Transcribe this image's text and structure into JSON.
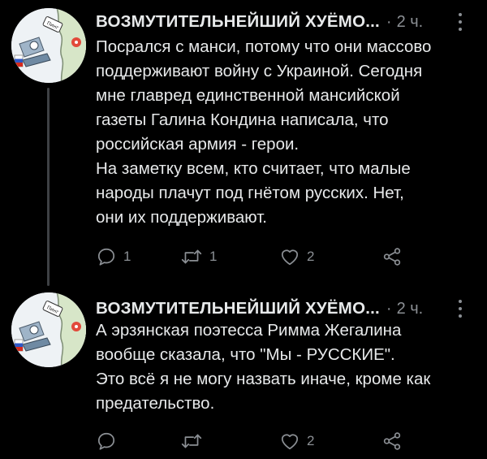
{
  "posts": [
    {
      "author": "ВОЗМУТИТЕЛЬНЕЙШИЙ ХУЁМО...",
      "separator": "·",
      "time": "2 ч.",
      "lines": [
        "Посрался с манси, потому что они массово",
        "поддерживают войну с Украиной. Сегодня",
        "мне главред единственной мансийской",
        "газеты Галина Кондина написала, что",
        "российская армия - герои.",
        "На заметку всем, кто считает, что малые",
        "народы плачут под гнётом русских. Нет,",
        "они их поддерживают."
      ],
      "actions": {
        "reply_count": "1",
        "retweet_count": "1",
        "like_count": "2"
      },
      "avatar_sign": "Пинг"
    },
    {
      "author": "ВОЗМУТИТЕЛЬНЕЙШИЙ ХУЁМО...",
      "separator": "·",
      "time": "2 ч.",
      "lines": [
        "А эрзянская поэтесса Римма Жегалина",
        "вообще сказала, что \"Мы - РУССКИЕ\".",
        "Это всё я не могу назвать иначе, кроме как",
        "предательство."
      ],
      "actions": {
        "reply_count": "",
        "retweet_count": "",
        "like_count": "2"
      },
      "avatar_sign": "Пинг"
    }
  ],
  "icons": {
    "reply": "reply-icon",
    "retweet": "retweet-icon",
    "like": "heart-icon",
    "share": "share-icon",
    "more": "more-vertical-icon"
  },
  "colors": {
    "background": "#000000",
    "text": "#e7e9ea",
    "secondary": "#8b8f94",
    "thread_line": "#3e4144"
  }
}
